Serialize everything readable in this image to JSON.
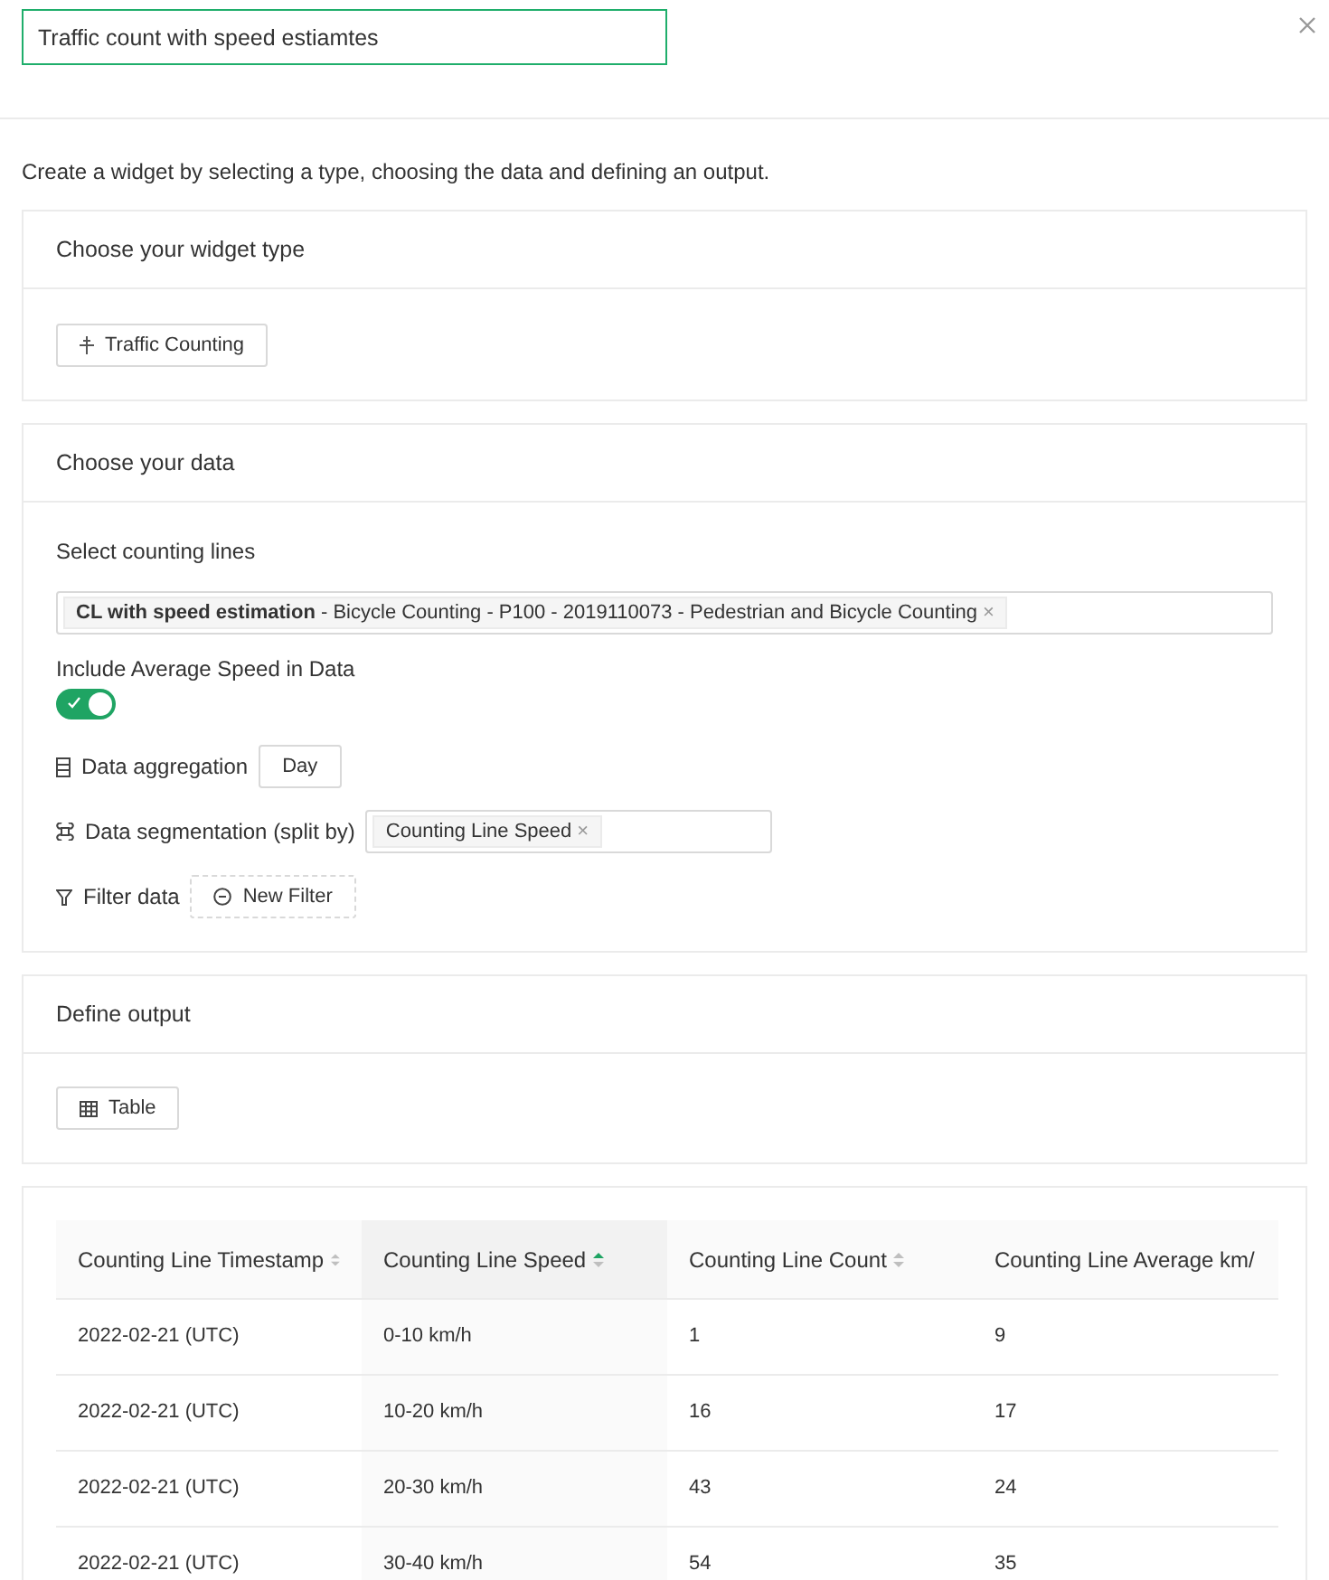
{
  "title_field": {
    "value": "Traffic count with speed estiamtes"
  },
  "intro": "Create a widget by selecting a type, choosing the data and defining an output.",
  "widget_type": {
    "heading": "Choose your widget type",
    "button": "Traffic Counting"
  },
  "data": {
    "heading": "Choose your data",
    "lines_label": "Select counting lines",
    "lines_tag": "**CL with speed estimation** - Bicycle Counting - P100 - 2019110073 - Pedestrian and Bicycle Counting",
    "lines_tag_remove": "×",
    "speed_label": "Include Average Speed in Data",
    "speed_on": true,
    "aggregation_label": "Data aggregation",
    "aggregation_value": "Day",
    "segmentation_label": "Data segmentation (split by)",
    "segmentation_tag": "Counting Line Speed",
    "segmentation_tag_remove": "×",
    "filter_label": "Filter data",
    "filter_button": "New Filter"
  },
  "output": {
    "heading": "Define output",
    "button": "Table"
  },
  "table": {
    "columns": [
      {
        "label": "Counting Line Timestamp",
        "sorted": false
      },
      {
        "label": "Counting Line Speed",
        "sorted": true
      },
      {
        "label": "Counting Line Count",
        "sorted": false
      },
      {
        "label": "Counting Line Average km/"
      }
    ],
    "rows": [
      [
        "2022-02-21 (UTC)",
        "0-10 km/h",
        "1",
        "9"
      ],
      [
        "2022-02-21 (UTC)",
        "10-20 km/h",
        "16",
        "17"
      ],
      [
        "2022-02-21 (UTC)",
        "20-30 km/h",
        "43",
        "24"
      ],
      [
        "2022-02-21 (UTC)",
        "30-40 km/h",
        "54",
        "35"
      ]
    ]
  }
}
